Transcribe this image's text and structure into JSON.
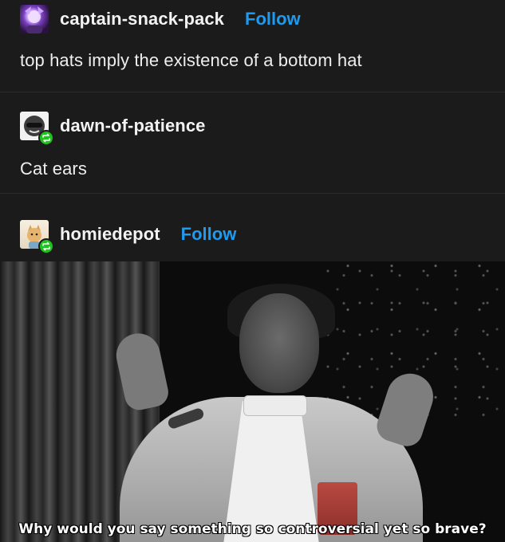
{
  "posts": [
    {
      "username": "captain-snack-pack",
      "follow_label": "Follow",
      "text": "top hats imply the existence of a bottom hat",
      "avatar_icon": "anime-avatar"
    },
    {
      "username": "dawn-of-patience",
      "text": "Cat ears",
      "avatar_icon": "sunglasses-avatar",
      "reblog_icon": "reblog-icon"
    },
    {
      "username": "homiedepot",
      "follow_label": "Follow",
      "avatar_icon": "cartoon-cat-avatar",
      "reblog_icon": "reblog-icon",
      "image_caption": "Why would you say something so controversial yet so brave?"
    }
  ],
  "colors": {
    "background": "#1b1b1b",
    "follow": "#1d9bf0",
    "reblog_badge": "#1ec41e",
    "text": "#eeeeee"
  }
}
